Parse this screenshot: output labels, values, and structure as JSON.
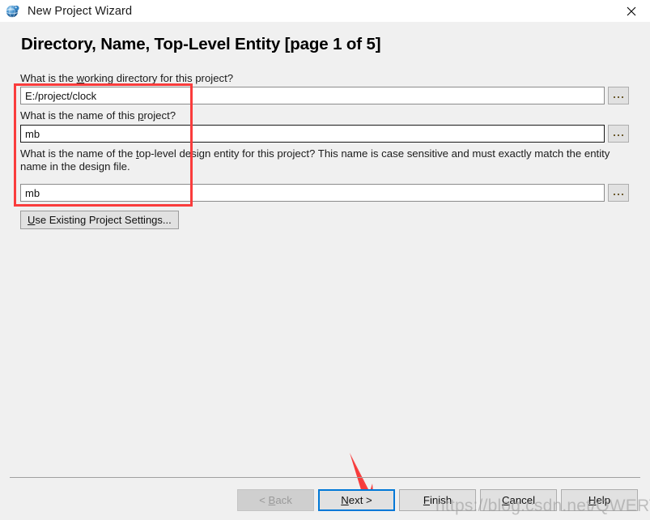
{
  "window": {
    "title": "New Project Wizard",
    "app_icon": "quartus-globe-icon",
    "close_icon": "close-icon"
  },
  "page": {
    "heading": "Directory, Name, Top-Level Entity [page 1 of 5]"
  },
  "fields": {
    "working_directory": {
      "label_before": "What is the ",
      "label_key": "w",
      "label_after": "orking directory for this project?",
      "value": "E:/project/clock",
      "placeholder": "",
      "browse_label": "..."
    },
    "project_name": {
      "label_before": "What is the name of this ",
      "label_key": "p",
      "label_after": "roject?",
      "value": "mb",
      "placeholder": "",
      "browse_label": "..."
    },
    "top_level_entity": {
      "label_before": "What is the name of the ",
      "label_key": "t",
      "label_after": "op-level design entity for this project? This name is case sensitive and must exactly match the entity name in the design file.",
      "value": "mb",
      "placeholder": "",
      "browse_label": "..."
    }
  },
  "buttons": {
    "use_existing_settings": {
      "key": "U",
      "rest": "se Existing Project Settings..."
    },
    "back": {
      "prefix": "< ",
      "key": "B",
      "rest": "ack",
      "disabled": true
    },
    "next": {
      "prefix": "",
      "key": "N",
      "rest": "ext >",
      "default": true
    },
    "finish": {
      "prefix": "",
      "key": "F",
      "rest": "inish"
    },
    "cancel": {
      "prefix": "",
      "key": "C",
      "rest": "ancel"
    },
    "help": {
      "prefix": "",
      "key": "H",
      "rest": "elp"
    }
  },
  "annotations": {
    "highlight_color": "#fa3c3c",
    "arrow_color": "#f73c3c",
    "rect_name": "red-highlight-rectangle",
    "arrow_name": "red-pointer-arrow"
  },
  "watermark": {
    "text": "https://blog.csdn.net/QWERTYzxw"
  }
}
